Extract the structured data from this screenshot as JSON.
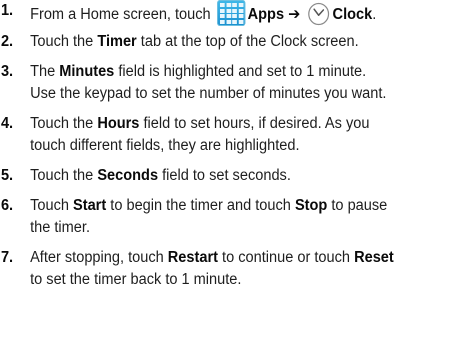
{
  "steps": [
    {
      "number": "1.",
      "parts": {
        "a": "From a Home screen, touch ",
        "apps": "Apps",
        "arrow": " ➔ ",
        "clock": "Clock",
        "end": "."
      }
    },
    {
      "number": "2.",
      "parts": {
        "a": "Touch the ",
        "timer": "Timer",
        "b": " tab at the top of the Clock screen."
      }
    },
    {
      "number": "3.",
      "parts": {
        "a": "The ",
        "minutes": "Minutes",
        "b": " field is highlighted and set to 1 minute.",
        "c": "Use the keypad to set the number of minutes you want."
      }
    },
    {
      "number": "4.",
      "parts": {
        "a": "Touch the ",
        "hours": "Hours",
        "b": " field to set hours, if desired. As you",
        "c": "touch different fields, they are highlighted."
      }
    },
    {
      "number": "5.",
      "parts": {
        "a": "Touch the ",
        "seconds": "Seconds",
        "b": " field to set seconds."
      }
    },
    {
      "number": "6.",
      "parts": {
        "a": "Touch ",
        "start": "Start",
        "b": " to begin the timer and touch ",
        "stop": "Stop",
        "c": " to pause",
        "d": "the timer."
      }
    },
    {
      "number": "7.",
      "parts": {
        "a": "After stopping, touch ",
        "restart": "Restart",
        "b": " to continue or touch ",
        "reset": "Reset",
        "c": "to set the timer back to 1 minute."
      }
    }
  ],
  "icons": {
    "apps": "apps-grid-icon",
    "clock": "clock-icon",
    "apps_color": "#1a8fcf",
    "clock_color": "#555555"
  }
}
